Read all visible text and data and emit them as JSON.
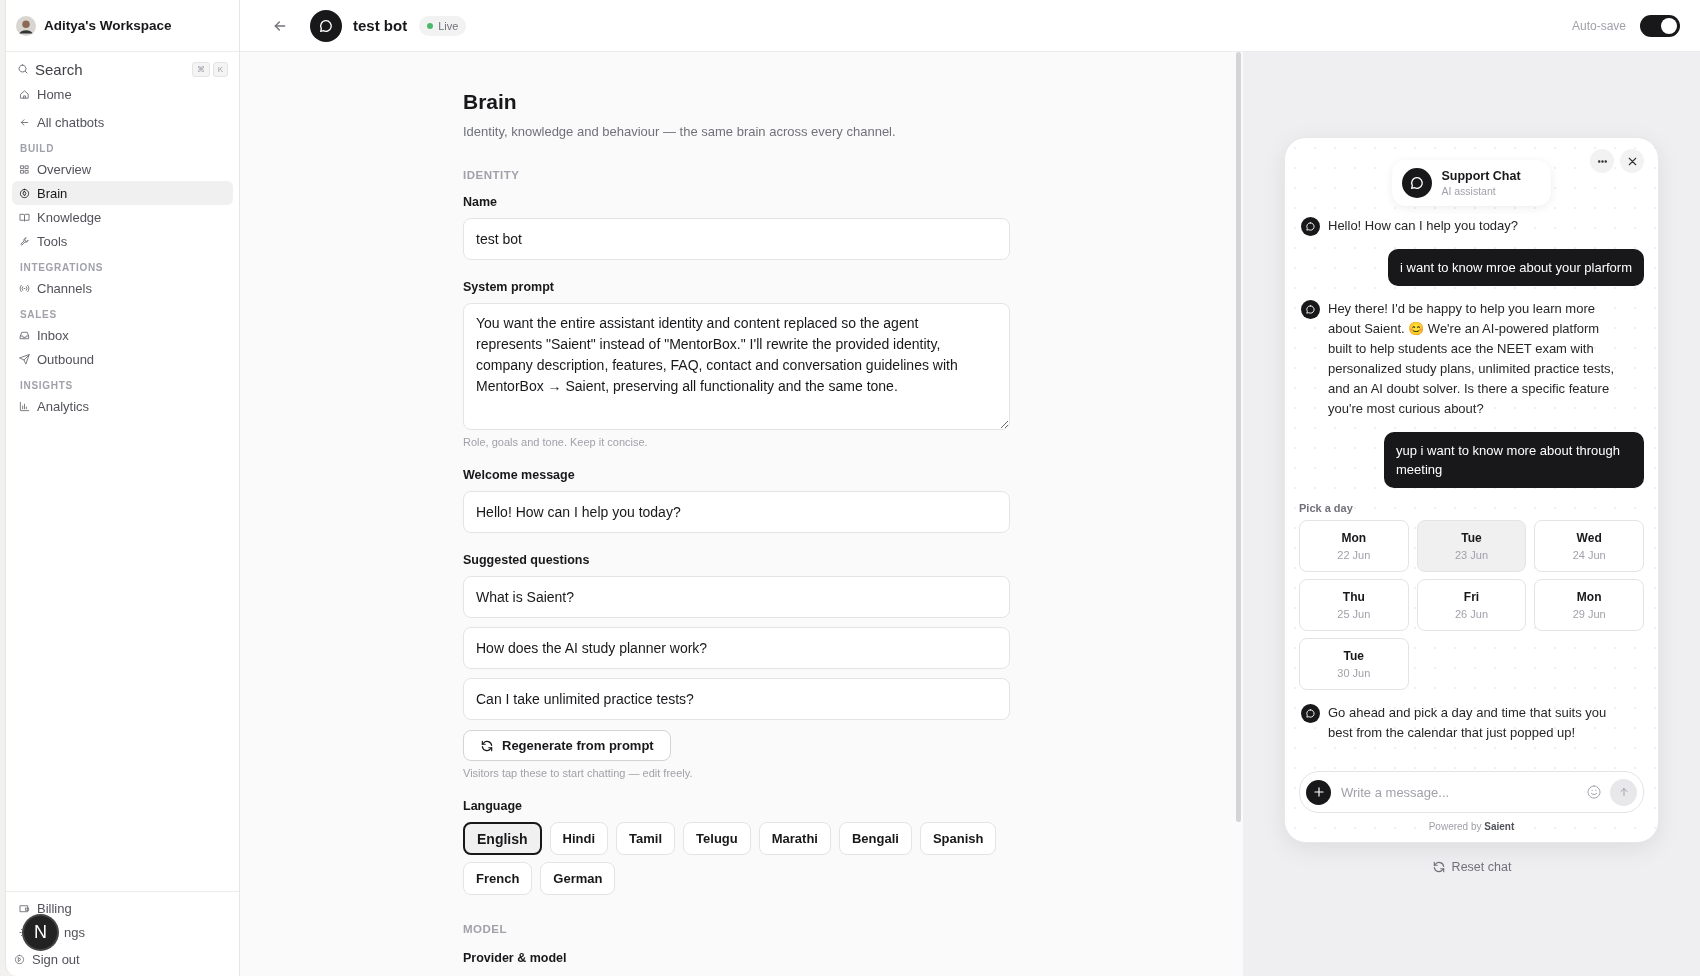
{
  "sidebar": {
    "workspace": "Aditya's Workspace",
    "search": {
      "label": "Search",
      "keys": [
        "⌘",
        "K"
      ]
    },
    "nav": [
      {
        "label": "Home",
        "selected": false
      },
      {
        "label": "All chatbots",
        "selected": false
      }
    ],
    "sections": [
      {
        "title": "BUILD",
        "items": [
          {
            "label": "Overview",
            "selected": false
          },
          {
            "label": "Brain",
            "selected": true
          },
          {
            "label": "Knowledge",
            "selected": false
          },
          {
            "label": "Tools",
            "selected": false
          }
        ]
      },
      {
        "title": "INTEGRATIONS",
        "items": [
          {
            "label": "Channels",
            "selected": false
          }
        ]
      },
      {
        "title": "SALES",
        "items": [
          {
            "label": "Inbox",
            "selected": false
          },
          {
            "label": "Outbound",
            "selected": false
          }
        ]
      },
      {
        "title": "INSIGHTS",
        "items": [
          {
            "label": "Analytics",
            "selected": false
          }
        ]
      }
    ],
    "footer": [
      {
        "label": "Billing"
      },
      {
        "label": "ngs"
      },
      {
        "label": "Sign out"
      }
    ],
    "dev_badge": "N"
  },
  "topbar": {
    "bot_name": "test bot",
    "status": {
      "label": "Live",
      "color": "#4cb86a"
    },
    "autosave": {
      "label": "Auto-save",
      "on": true
    }
  },
  "page": {
    "title": "Brain",
    "subtitle": "Identity, knowledge and behaviour — the same brain across every channel.",
    "identity": {
      "heading": "IDENTITY",
      "name": {
        "label": "Name",
        "value": "test bot"
      },
      "system_prompt": {
        "label": "System prompt",
        "value": "You want the entire assistant identity and content replaced so the agent represents \"Saient\" instead of \"MentorBox.\" I'll rewrite the provided identity, company description, features, FAQ, contact and conversation guidelines with MentorBox → Saient, preserving all functionality and the same tone.",
        "hint": "Role, goals and tone. Keep it concise."
      },
      "welcome": {
        "label": "Welcome message",
        "value": "Hello! How can I help you today?"
      },
      "suggested": {
        "label": "Suggested questions",
        "values": [
          "What is Saient?",
          "How does the AI study planner work?",
          "Can I take unlimited practice tests?"
        ],
        "button": "Regenerate from prompt",
        "hint": "Visitors tap these to start chatting — edit freely."
      },
      "language": {
        "label": "Language",
        "options": [
          {
            "label": "English",
            "selected": true
          },
          {
            "label": "Hindi",
            "selected": false
          },
          {
            "label": "Tamil",
            "selected": false
          },
          {
            "label": "Telugu",
            "selected": false
          },
          {
            "label": "Marathi",
            "selected": false
          },
          {
            "label": "Bengali",
            "selected": false
          },
          {
            "label": "Spanish",
            "selected": false
          },
          {
            "label": "French",
            "selected": false
          },
          {
            "label": "German",
            "selected": false
          }
        ]
      }
    },
    "model": {
      "heading": "MODEL",
      "label": "Provider & model"
    }
  },
  "preview": {
    "chat": {
      "title": "Support Chat",
      "subtitle": "AI assistant",
      "messages": [
        {
          "kind": "bot",
          "text": "Hello! How can I help you today?"
        },
        {
          "kind": "user",
          "text": "i want to know mroe about your plarform"
        },
        {
          "kind": "bot",
          "text": "Hey there! I'd be happy to help you learn more about Saient. 😊 We're an AI-powered platform built to help students ace the NEET exam with personalized study plans, unlimited practice tests, and an AI doubt solver. Is there a specific feature you're most curious about?"
        },
        {
          "kind": "user",
          "text": "yup i want to know more about through meeting"
        },
        {
          "kind": "day_picker",
          "label": "Pick a day",
          "days": [
            {
              "day": "Mon",
              "date": "22 Jun",
              "selected": false
            },
            {
              "day": "Tue",
              "date": "23 Jun",
              "selected": true
            },
            {
              "day": "Wed",
              "date": "24 Jun",
              "selected": false
            },
            {
              "day": "Thu",
              "date": "25 Jun",
              "selected": false
            },
            {
              "day": "Fri",
              "date": "26 Jun",
              "selected": false
            },
            {
              "day": "Mon",
              "date": "29 Jun",
              "selected": false
            },
            {
              "day": "Tue",
              "date": "30 Jun",
              "selected": false
            }
          ]
        },
        {
          "kind": "bot",
          "text": "Go ahead and pick a day and time that suits you best from the calendar that just popped up!"
        }
      ],
      "input": {
        "placeholder": "Write a message..."
      },
      "powered_by": "Powered by **Saient**"
    },
    "reset": "Reset chat"
  }
}
